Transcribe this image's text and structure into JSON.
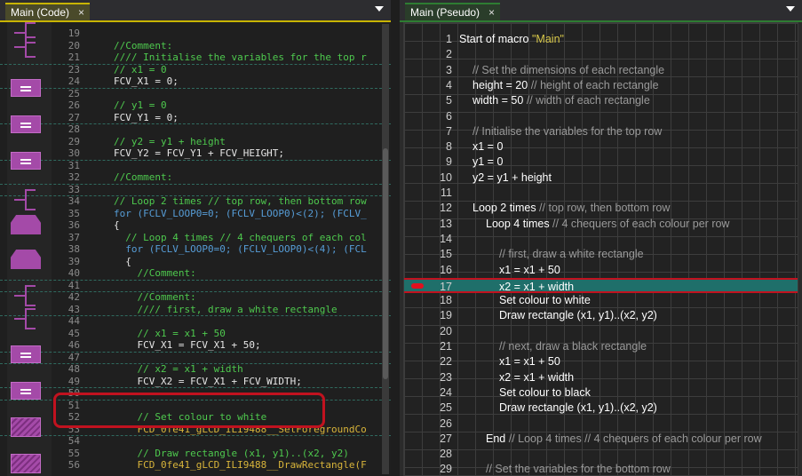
{
  "left_panel": {
    "tab_label": "Main (Code)",
    "close_glyph": "×",
    "menu_icon": "chevron-down-icon",
    "flow_icons": [
      "comment-icon",
      "comment-icon",
      "calculation-icon",
      "calculation-icon",
      "calculation-icon",
      "comment-icon",
      "loop-icon",
      "loop-icon",
      "comment-icon",
      "comment-icon",
      "calculation-icon",
      "calculation-icon",
      "component-macro-icon",
      "component-macro-icon"
    ],
    "lines": [
      {
        "n": "19",
        "t": ""
      },
      {
        "n": "20",
        "t": "//Comment:"
      },
      {
        "n": "21",
        "t": "//// Initialise the variables for the top r"
      },
      {
        "n": "23",
        "t": "// x1 = 0"
      },
      {
        "n": "24",
        "t": "FCV_X1 = 0;"
      },
      {
        "n": "25",
        "t": ""
      },
      {
        "n": "26",
        "t": "// y1 = 0"
      },
      {
        "n": "27",
        "t": "FCV_Y1 = 0;"
      },
      {
        "n": "28",
        "t": ""
      },
      {
        "n": "29",
        "t": "// y2 = y1 + height"
      },
      {
        "n": "30",
        "t": "FCV_Y2 = FCV_Y1 + FCV_HEIGHT;"
      },
      {
        "n": "31",
        "t": ""
      },
      {
        "n": "32",
        "t": "//Comment:"
      },
      {
        "n": "33",
        "t": ""
      },
      {
        "n": "34",
        "t": "// Loop 2 times // top row, then bottom row"
      },
      {
        "n": "35",
        "t": "for (FCLV_LOOP0=0; (FCLV_LOOP0)<(2); (FCLV_"
      },
      {
        "n": "36",
        "t": "{"
      },
      {
        "n": "37",
        "t": "  // Loop 4 times // 4 chequers of each col"
      },
      {
        "n": "38",
        "t": "  for (FCLV_LOOP0=0; (FCLV_LOOP0)<(4); (FCL"
      },
      {
        "n": "39",
        "t": "  {"
      },
      {
        "n": "40",
        "t": "    //Comment:"
      },
      {
        "n": "41",
        "t": ""
      },
      {
        "n": "42",
        "t": "    //Comment:"
      },
      {
        "n": "43",
        "t": "    //// first, draw a white rectangle"
      },
      {
        "n": "44",
        "t": ""
      },
      {
        "n": "45",
        "t": "    // x1 = x1 + 50"
      },
      {
        "n": "46",
        "t": "    FCV_X1 = FCV_X1 + 50;"
      },
      {
        "n": "47",
        "t": ""
      },
      {
        "n": "48",
        "t": "    // x2 = x1 + width"
      },
      {
        "n": "49",
        "t": "    FCV_X2 = FCV_X1 + FCV_WIDTH;"
      },
      {
        "n": "50",
        "t": ""
      },
      {
        "n": "51",
        "t": ""
      },
      {
        "n": "52",
        "t": "    // Set colour to white"
      },
      {
        "n": "53",
        "t": "    FCD_0fe41_gLCD_ILI9488__SetForegroundCo"
      },
      {
        "n": "54",
        "t": ""
      },
      {
        "n": "55",
        "t": "    // Draw rectangle (x1, y1)..(x2, y2)"
      },
      {
        "n": "56",
        "t": "    FCD_0fe41_gLCD_ILI9488__DrawRectangle(F"
      }
    ]
  },
  "right_panel": {
    "tab_label": "Main (Pseudo)",
    "close_glyph": "×",
    "menu_icon": "chevron-down-icon",
    "active_line": "17",
    "breakpoint_line": "17",
    "lines": [
      {
        "n": "1",
        "indent": 0,
        "code": "Start of macro  ",
        "str": "\"Main\"",
        "cmt": ""
      },
      {
        "n": "2",
        "indent": 0,
        "code": "",
        "str": "",
        "cmt": ""
      },
      {
        "n": "3",
        "indent": 1,
        "code": "",
        "str": "",
        "cmt": "// Set the dimensions of each rectangle"
      },
      {
        "n": "4",
        "indent": 1,
        "code": "height = 20  ",
        "str": "",
        "cmt": "// height of each rectangle"
      },
      {
        "n": "5",
        "indent": 1,
        "code": "width = 50  ",
        "str": "",
        "cmt": "// width of each rectangle"
      },
      {
        "n": "6",
        "indent": 0,
        "code": "",
        "str": "",
        "cmt": ""
      },
      {
        "n": "7",
        "indent": 1,
        "code": "",
        "str": "",
        "cmt": "// Initialise the variables for the top row"
      },
      {
        "n": "8",
        "indent": 1,
        "code": "x1 = 0",
        "str": "",
        "cmt": ""
      },
      {
        "n": "9",
        "indent": 1,
        "code": "y1 = 0",
        "str": "",
        "cmt": ""
      },
      {
        "n": "10",
        "indent": 1,
        "code": "y2 = y1 + height",
        "str": "",
        "cmt": ""
      },
      {
        "n": "11",
        "indent": 0,
        "code": "",
        "str": "",
        "cmt": ""
      },
      {
        "n": "12",
        "indent": 1,
        "code": "Loop 2 times  ",
        "str": "",
        "cmt": "// top row, then bottom row"
      },
      {
        "n": "13",
        "indent": 2,
        "code": "Loop 4 times  ",
        "str": "",
        "cmt": "// 4 chequers of each colour per row"
      },
      {
        "n": "14",
        "indent": 0,
        "code": "",
        "str": "",
        "cmt": ""
      },
      {
        "n": "15",
        "indent": 3,
        "code": "",
        "str": "",
        "cmt": "// first, draw a white rectangle"
      },
      {
        "n": "16",
        "indent": 3,
        "code": "x1 = x1 + 50",
        "str": "",
        "cmt": ""
      },
      {
        "n": "17",
        "indent": 3,
        "code": "x2 = x1 + width",
        "str": "",
        "cmt": ""
      },
      {
        "n": "18",
        "indent": 3,
        "code": "Set colour to white",
        "str": "",
        "cmt": ""
      },
      {
        "n": "19",
        "indent": 3,
        "code": "Draw rectangle (x1, y1)..(x2, y2)",
        "str": "",
        "cmt": ""
      },
      {
        "n": "20",
        "indent": 0,
        "code": "",
        "str": "",
        "cmt": ""
      },
      {
        "n": "21",
        "indent": 3,
        "code": "",
        "str": "",
        "cmt": "// next, draw a black rectangle"
      },
      {
        "n": "22",
        "indent": 3,
        "code": "x1 = x1 + 50",
        "str": "",
        "cmt": ""
      },
      {
        "n": "23",
        "indent": 3,
        "code": "x2 = x1 + width",
        "str": "",
        "cmt": ""
      },
      {
        "n": "24",
        "indent": 3,
        "code": "Set colour to black",
        "str": "",
        "cmt": ""
      },
      {
        "n": "25",
        "indent": 3,
        "code": "Draw rectangle (x1, y1)..(x2, y2)",
        "str": "",
        "cmt": ""
      },
      {
        "n": "26",
        "indent": 0,
        "code": "",
        "str": "",
        "cmt": ""
      },
      {
        "n": "27",
        "indent": 2,
        "code": "End  ",
        "str": "",
        "cmt": "// Loop 4 times // 4 chequers of each colour per row"
      },
      {
        "n": "28",
        "indent": 0,
        "code": "",
        "str": "",
        "cmt": ""
      },
      {
        "n": "29",
        "indent": 2,
        "code": "",
        "str": "",
        "cmt": "// Set the variables for the bottom row"
      }
    ]
  },
  "colors": {
    "code_tab_accent": "#c8b400",
    "pseudo_tab_accent": "#2e7d32",
    "flowchart_icon": "#a44aa8",
    "highlight_red": "#c1121f",
    "active_line_bg": "#1f6f6a",
    "comment_green": "#4ec94e"
  }
}
